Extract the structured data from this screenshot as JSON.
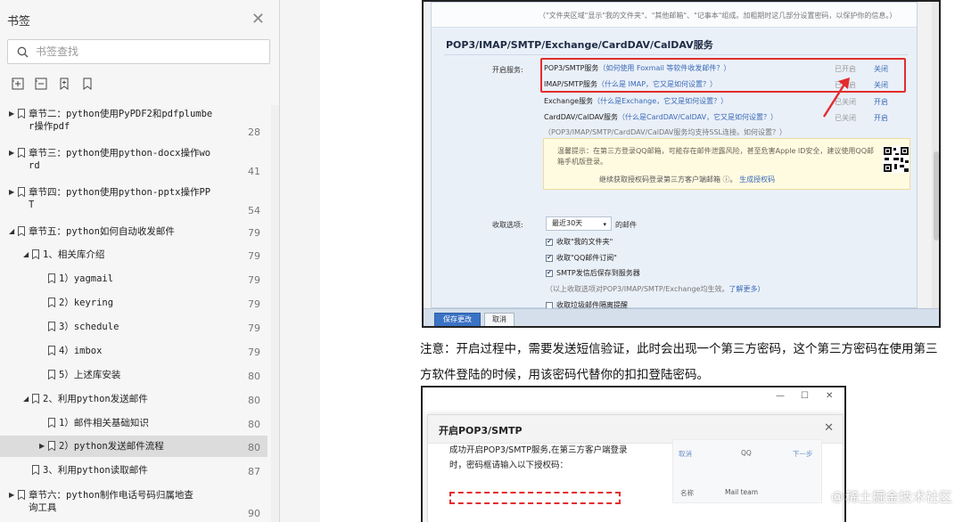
{
  "sidebar": {
    "title": "书签",
    "search_placeholder": "书签查找",
    "tree": [
      {
        "label": "章节二：python使用PyPDF2和pdfplumbe\nr操作pdf",
        "page": "28",
        "level": 0,
        "arrow": "collapsed"
      },
      {
        "label": "章节三：python使用python-docx操作wo\nrd",
        "page": "41",
        "level": 0,
        "arrow": "collapsed"
      },
      {
        "label": "章节四：python使用python-pptx操作PP\nT",
        "page": "54",
        "level": 0,
        "arrow": "collapsed"
      },
      {
        "label": "章节五：python如何自动收发邮件",
        "page": "79",
        "level": 0,
        "arrow": "expanded"
      },
      {
        "label": "1、相关库介绍",
        "page": "79",
        "level": 1,
        "arrow": "expanded"
      },
      {
        "label": "1）yagmail",
        "page": "79",
        "level": 2,
        "arrow": "none"
      },
      {
        "label": "2）keyring",
        "page": "79",
        "level": 2,
        "arrow": "none"
      },
      {
        "label": "3）schedule",
        "page": "79",
        "level": 2,
        "arrow": "none"
      },
      {
        "label": "4）imbox",
        "page": "79",
        "level": 2,
        "arrow": "none"
      },
      {
        "label": "5）上述库安装",
        "page": "80",
        "level": 2,
        "arrow": "none"
      },
      {
        "label": "2、利用python发送邮件",
        "page": "80",
        "level": 1,
        "arrow": "expanded"
      },
      {
        "label": "1）邮件相关基础知识",
        "page": "80",
        "level": 2,
        "arrow": "none"
      },
      {
        "label": "2）python发送邮件流程",
        "page": "80",
        "level": 2,
        "arrow": "collapsed",
        "selected": true
      },
      {
        "label": "3、利用python读取邮件",
        "page": "87",
        "level": 1,
        "arrow": "none"
      },
      {
        "label": "章节六：python制作电话号码归属地查\n询工具",
        "page": "90",
        "level": 0,
        "arrow": "collapsed"
      }
    ]
  },
  "shot1": {
    "note": "（\"文件夹区域\"显示\"我的文件夹\"、\"其他邮箱\"、\"记事本\"组成。加粗期时这几部分设置密码，以保护你的信息。）",
    "section_title": "POP3/IMAP/SMTP/Exchange/CardDAV/CalDAV服务",
    "enable_label": "开启服务:",
    "services": [
      {
        "name": "POP3/SMTP服务",
        "hint": "（如何使用 Foxmail 等软件收发邮件？）",
        "state": "已开启",
        "action": "关闭"
      },
      {
        "name": "IMAP/SMTP服务",
        "hint": "（什么是 IMAP，它又是如何设置？）",
        "state": "已开启",
        "action": "关闭"
      },
      {
        "name": "Exchange服务",
        "hint": "（什么是Exchange，它又是如何设置？）",
        "state": "已关闭",
        "action": "开启"
      },
      {
        "name": "CardDAV/CalDAV服务",
        "hint": "（什么是CardDAV/CalDAV，它又是如何设置？）",
        "state": "已关闭",
        "action": "开启"
      }
    ],
    "ssl_note": "（POP3/IMAP/SMTP/CardDAV/CalDAV服务均支持SSL连接。如何设置？）",
    "tip_text": "温馨提示：在第三方登录QQ邮箱，可能存在邮件泄露风险，甚至危害Apple ID安全，建议使用QQ邮箱手机版登录。",
    "tip_link_prefix": "继续获取授权码登录第三方客户端邮箱 ⓘ。",
    "tip_link": "生成授权码",
    "recv_label": "收取选项:",
    "recv_select": "最近30天",
    "recv_suffix": "的邮件",
    "checks": [
      "收取\"我的文件夹\"",
      "收取\"QQ邮件订阅\"",
      "SMTP发信后保存到服务器"
    ],
    "scope_note": "（以上收取选项对POP3/IMAP/SMTP/Exchange均生效。",
    "scope_link": "了解更多）",
    "junk_check": "收取垃圾邮件隔离提醒",
    "save_btn": "保存更改",
    "cancel_btn": "取消"
  },
  "body": {
    "paragraph": "注意：开启过程中，需要发送短信验证，此时会出现一个第三方密码，这个第三方密码在使用第三方软件登陆的时候，用该密码代替你的扣扣登陆密码。"
  },
  "shot2": {
    "dialog_title": "开启POP3/SMTP",
    "message": "成功开启POP3/SMTP服务,在第三方客户端登录时，密码框请输入以下授权码：",
    "side_cancel": "取消",
    "side_title": "QQ",
    "side_next": "下一步",
    "side_field": "名称",
    "side_value": "Mail team"
  },
  "watermark": "稀土掘金技术社区",
  "colors": {
    "accent_red": "#e32c2c",
    "link_blue": "#3a6ab8",
    "save_blue": "#3a72c4"
  }
}
